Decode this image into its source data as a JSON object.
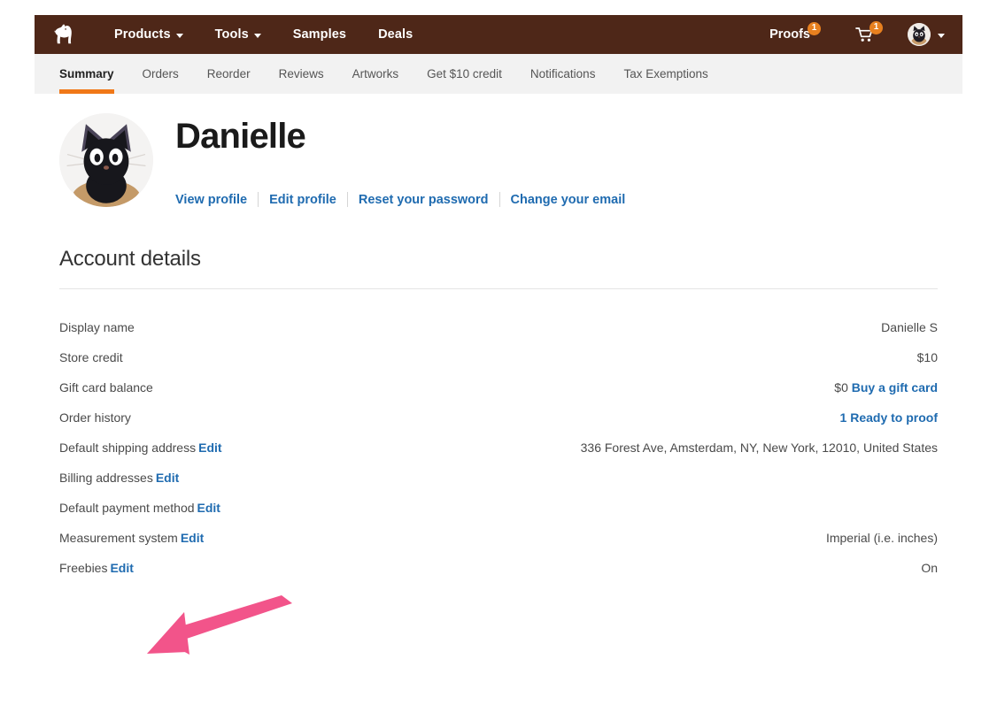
{
  "topnav": {
    "logo_icon": "horse-logo-icon",
    "items": [
      {
        "label": "Products",
        "has_caret": true
      },
      {
        "label": "Tools",
        "has_caret": true
      },
      {
        "label": "Samples",
        "has_caret": false
      },
      {
        "label": "Deals",
        "has_caret": false
      }
    ],
    "proofs_label": "Proofs",
    "proofs_badge": "1",
    "cart_icon": "shopping-cart-icon",
    "cart_badge": "1",
    "avatar_icon": "user-avatar-cat-icon",
    "brand_color": "#4E2718",
    "badge_color": "#E8801F"
  },
  "subnav": {
    "tabs": [
      {
        "label": "Summary",
        "active": true
      },
      {
        "label": "Orders",
        "active": false
      },
      {
        "label": "Reorder",
        "active": false
      },
      {
        "label": "Reviews",
        "active": false
      },
      {
        "label": "Artworks",
        "active": false
      },
      {
        "label": "Get $10 credit",
        "active": false
      },
      {
        "label": "Notifications",
        "active": false
      },
      {
        "label": "Tax Exemptions",
        "active": false
      }
    ],
    "active_underline_color": "#F07818"
  },
  "profile": {
    "avatar_icon": "profile-avatar-cat-icon",
    "name": "Danielle",
    "links": [
      "View profile",
      "Edit profile",
      "Reset your password",
      "Change your email"
    ],
    "link_color": "#1F6BB0"
  },
  "account_details": {
    "title": "Account details",
    "edit_label": "Edit",
    "rows": [
      {
        "label": "Display name",
        "edit": false,
        "value": "Danielle S",
        "value_link": "",
        "clipped": true
      },
      {
        "label": "Store credit",
        "edit": false,
        "value": "$10",
        "value_link": "",
        "clipped": false
      },
      {
        "label": "Gift card balance",
        "edit": false,
        "value": "$0",
        "value_link": "Buy a gift card",
        "clipped": false
      },
      {
        "label": "Order history",
        "edit": false,
        "value": "",
        "value_link": "1 Ready to proof",
        "clipped": false
      },
      {
        "label": "Default shipping address",
        "edit": true,
        "value": "336 Forest Ave, Amsterdam, NY, New York, 12010, United States",
        "value_link": "",
        "clipped": false
      },
      {
        "label": "Billing addresses",
        "edit": true,
        "value": "",
        "value_link": "",
        "clipped": false
      },
      {
        "label": "Default payment method",
        "edit": true,
        "value": "",
        "value_link": "",
        "clipped": false
      },
      {
        "label": "Measurement system",
        "edit": true,
        "value": "Imperial (i.e. inches)",
        "value_link": "",
        "clipped": false
      },
      {
        "label": "Freebies",
        "edit": true,
        "value": "On",
        "value_link": "",
        "clipped": false
      }
    ]
  },
  "annotation": {
    "name": "pointer-arrow-to-freebies-edit",
    "color": "#F2548A"
  }
}
